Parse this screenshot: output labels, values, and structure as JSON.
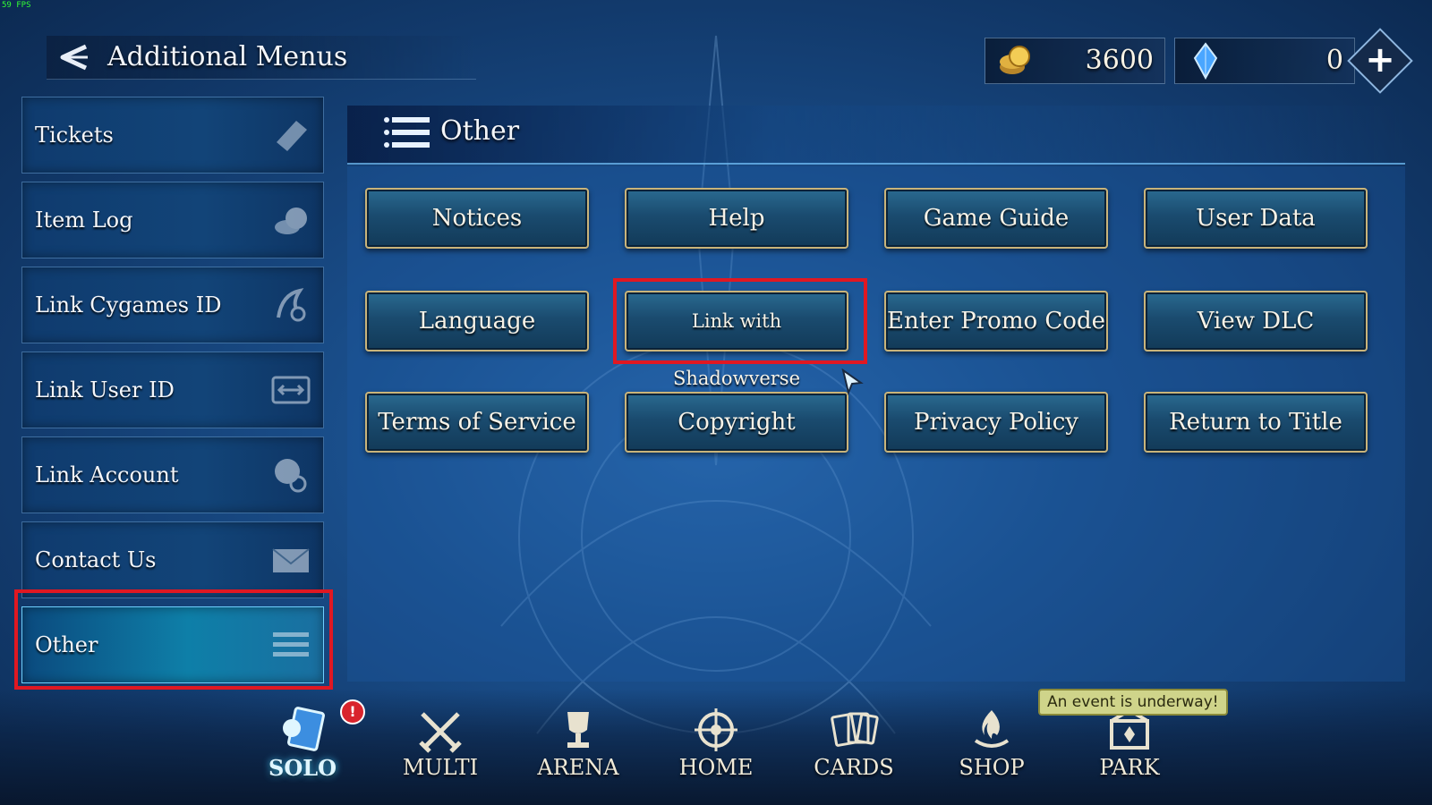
{
  "fps": "59 FPS",
  "header": {
    "title": "Additional Menus"
  },
  "currency": {
    "gold": "3600",
    "crystals": "0"
  },
  "sidebar": {
    "items": [
      {
        "label": "Tickets",
        "icon": "ticket-icon"
      },
      {
        "label": "Item Log",
        "icon": "coins-icon"
      },
      {
        "label": "Link Cygames ID",
        "icon": "link-cygames-icon"
      },
      {
        "label": "Link User ID",
        "icon": "link-user-id-icon"
      },
      {
        "label": "Link Account",
        "icon": "link-account-icon"
      },
      {
        "label": "Contact Us",
        "icon": "envelope-icon"
      },
      {
        "label": "Other",
        "icon": "list-icon",
        "active": true
      }
    ]
  },
  "panel": {
    "title": "Other",
    "buttons": [
      "Notices",
      "Help",
      "Game Guide",
      "User Data",
      "Language",
      "Link with Shadowverse",
      "Enter Promo Code",
      "View DLC",
      "Terms of Service",
      "Copyright",
      "Privacy Policy",
      "Return to Title"
    ]
  },
  "nav": {
    "items": [
      {
        "label": "SOLO",
        "icon": "solo-cards-icon",
        "active": true
      },
      {
        "label": "MULTI",
        "icon": "crossed-swords-icon"
      },
      {
        "label": "ARENA",
        "icon": "trophy-icon"
      },
      {
        "label": "HOME",
        "icon": "home-emblem-icon"
      },
      {
        "label": "CARDS",
        "icon": "card-deck-icon"
      },
      {
        "label": "SHOP",
        "icon": "shop-flame-icon"
      },
      {
        "label": "PARK",
        "icon": "park-gate-icon"
      }
    ],
    "solo_badge": "!",
    "event_tooltip": "An event is underway!"
  },
  "colors": {
    "highlight": "#e01822",
    "button_border": "#c9b47a",
    "accent": "#6fd0ff"
  }
}
